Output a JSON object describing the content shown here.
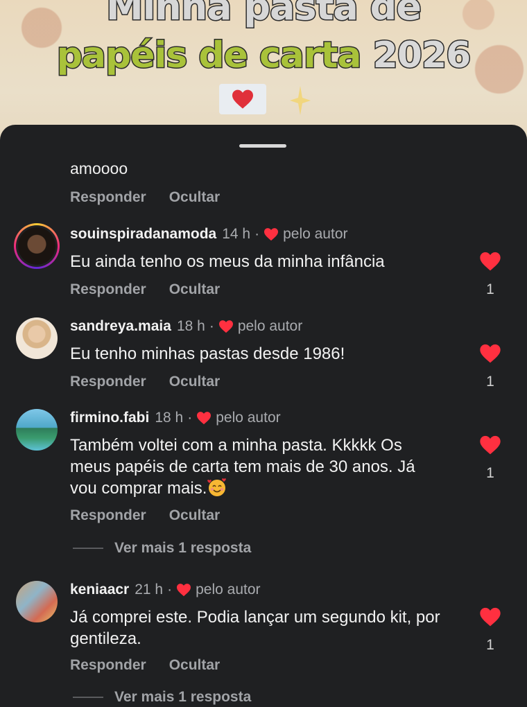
{
  "background": {
    "title_line1": "Minha pasta de",
    "title_line2_text": "papéis de carta",
    "title_line2_year": "2026"
  },
  "sheet": {
    "first_comment_text": "amoooo",
    "reply_label": "Responder",
    "hide_label": "Ocultar",
    "view_more_label": "Ver mais 1 resposta",
    "by_author_label": "pelo autor"
  },
  "comments": [
    {
      "username": "souinspiradanamoda",
      "time": "14 h",
      "text": "Eu ainda tenho os meus da minha infância",
      "likes": "1",
      "has_story_ring": true
    },
    {
      "username": "sandreya.maia",
      "time": "18 h",
      "text": "Eu tenho minhas pastas desde 1986!",
      "likes": "1"
    },
    {
      "username": "firmino.fabi",
      "time": "18 h",
      "text": "Também voltei com a minha pasta. Kkkkk Os meus papéis de carta tem mais de 30 anos. Já vou comprar mais.",
      "emoji": "smiling-face-with-hearts",
      "likes": "1"
    },
    {
      "username": "keniaacr",
      "time": "21 h",
      "text": "Já comprei este. Podia lançar um segundo kit, por gentileza.",
      "likes": "1"
    }
  ],
  "colors": {
    "sheet_bg": "#1f2022",
    "heart_red": "#ff3040",
    "secondary_text": "#a1a3a7",
    "title_green": "#a9c23a"
  }
}
